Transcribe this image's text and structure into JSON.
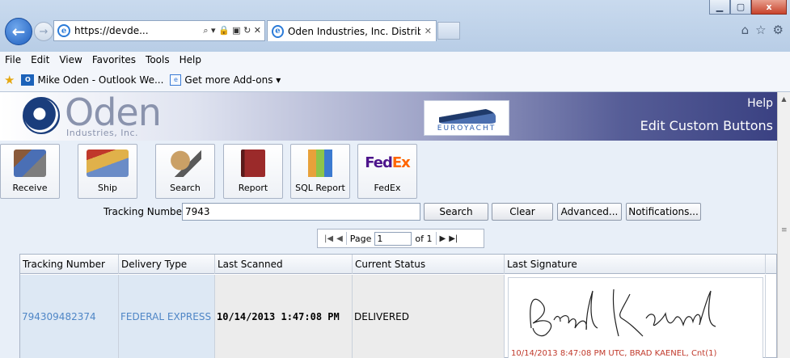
{
  "browser": {
    "address": "https://devde...",
    "address_tools": "⌕ ▾ 🔒 ▣ ↻ ✕",
    "tab_title": "Oden Industries, Inc. Distrib...",
    "tab_close": "✕",
    "window_buttons": {
      "minimize": "▁",
      "maximize": "▢",
      "close": "x"
    },
    "right_icons": {
      "home": "⌂",
      "star": "☆",
      "gear": "⚙"
    },
    "back": "←",
    "forward": "→"
  },
  "menu": [
    "File",
    "Edit",
    "View",
    "Favorites",
    "Tools",
    "Help"
  ],
  "favorites": {
    "items": [
      {
        "label": "Mike Oden - Outlook We...",
        "icon": "outlook-icon"
      },
      {
        "label": "Get more Add-ons ▾",
        "icon": "page-icon"
      }
    ]
  },
  "header": {
    "logo_name": "Oden",
    "logo_sub": "Industries, Inc.",
    "partner_text": "EUROYACHT",
    "help": "Help",
    "custom_buttons": "Edit Custom Buttons"
  },
  "toolbar": [
    {
      "label": "Receive",
      "icon": "receive-icon"
    },
    {
      "label": "Ship",
      "icon": "ship-icon"
    },
    {
      "label": "Search",
      "icon": "search-icon"
    },
    {
      "label": "Report",
      "icon": "report-icon"
    },
    {
      "label": "SQL Report",
      "icon": "sql-report-icon"
    },
    {
      "label": "FedEx",
      "icon": "fedex-icon"
    }
  ],
  "fedex_logo": {
    "fed": "Fed",
    "ex": "Ex"
  },
  "search": {
    "label": "Tracking Number:",
    "value": "7943",
    "search_btn": "Search",
    "clear_btn": "Clear",
    "advanced_btn": "Advanced...",
    "notifications_btn": "Notifications..."
  },
  "pager": {
    "page_label": "Page",
    "page_value": "1",
    "of_label": "of 1",
    "first": "|◀",
    "prev": "◀",
    "next": "▶",
    "last": "▶|"
  },
  "table": {
    "columns": [
      "Tracking Number",
      "Delivery Type",
      "Last Scanned",
      "Current Status",
      "Last Signature"
    ],
    "rows": [
      {
        "tracking": "794309482374",
        "delivery_type": "FEDERAL EXPRESS",
        "last_scanned": "10/14/2013 1:47:08 PM",
        "status": "DELIVERED",
        "signature_caption": "10/14/2013 8:47:08 PM UTC, BRAD KAENEL, Cnt(1)"
      }
    ]
  },
  "colors": {
    "link": "#4f86c6",
    "signature_caption": "#c0392b",
    "fedex_purple": "#4d148c",
    "fedex_orange": "#ff6600"
  }
}
